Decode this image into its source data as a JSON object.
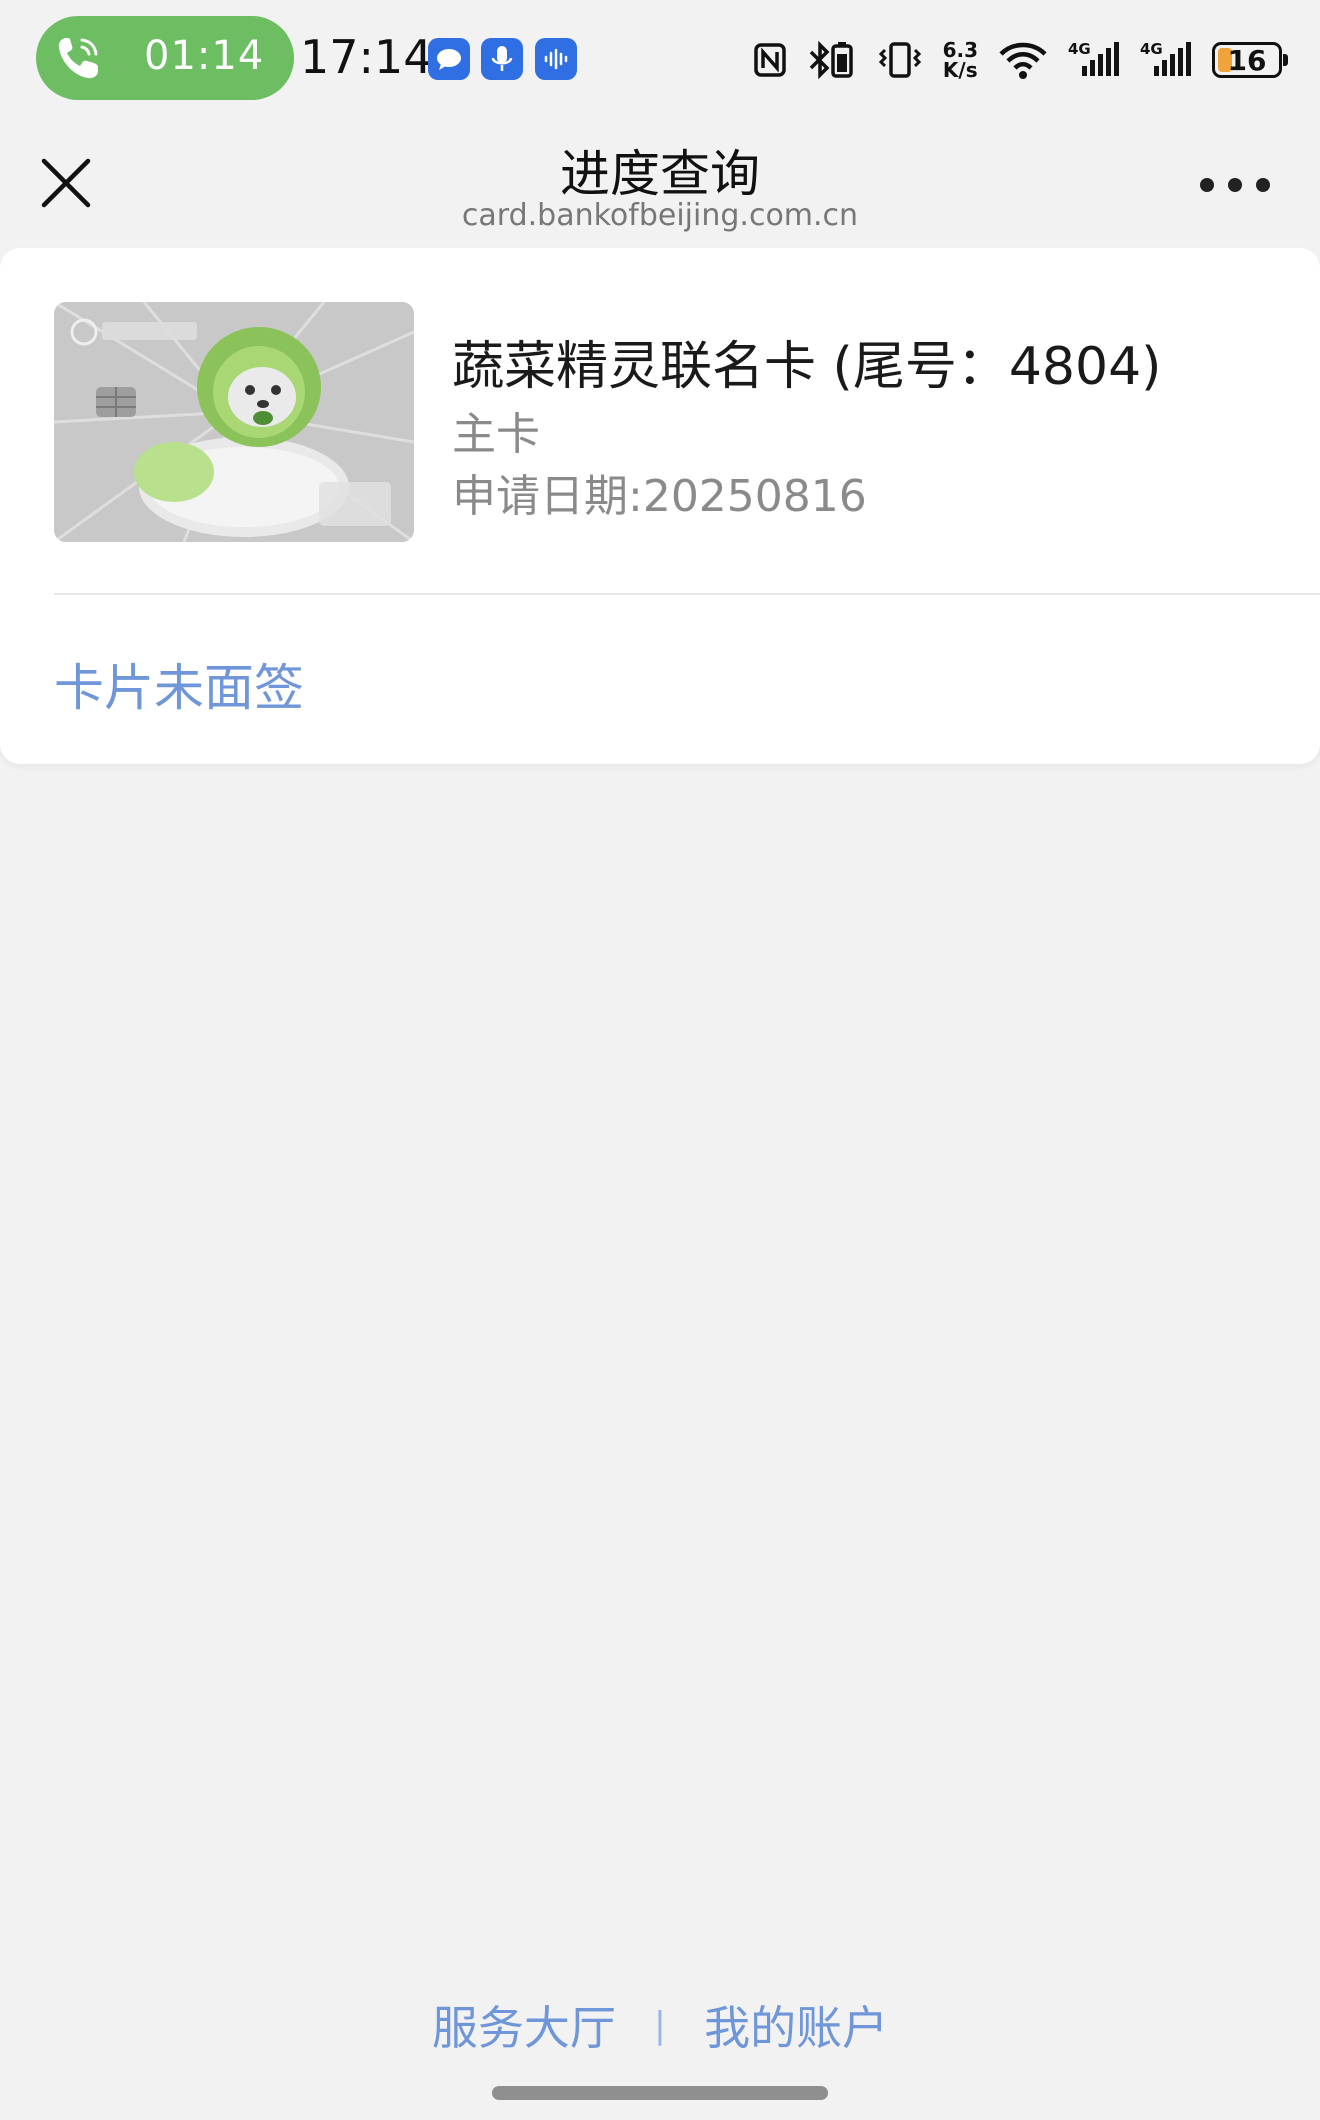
{
  "status_bar": {
    "call_timer": "01:14",
    "clock": "17:14",
    "net_speed_value": "6.3",
    "net_speed_unit": "K/s",
    "battery_level": "16",
    "notification_icons": [
      "message-icon",
      "microphone-icon",
      "audio-wave-icon"
    ],
    "system_icons": [
      "nfc-icon",
      "bluetooth-battery-icon",
      "vibrate-icon",
      "wifi-icon",
      "signal-4g-icon",
      "signal-4g-icon"
    ]
  },
  "header": {
    "title": "进度查询",
    "url": "card.bankofbeijing.com.cn"
  },
  "card": {
    "name": "蔬菜精灵联名卡 (尾号：4804)",
    "type": "主卡",
    "apply_date": "申请日期:20250816",
    "status": "卡片未面签"
  },
  "footer": {
    "links": [
      "服务大厅",
      "我的账户"
    ],
    "separator": "|"
  },
  "colors": {
    "accent_link": "#6f96d8",
    "call_pill": "#6dbe63",
    "background": "#f2f2f2",
    "notification_blue": "#2f6fe3",
    "battery_low": "#f0a33a"
  }
}
